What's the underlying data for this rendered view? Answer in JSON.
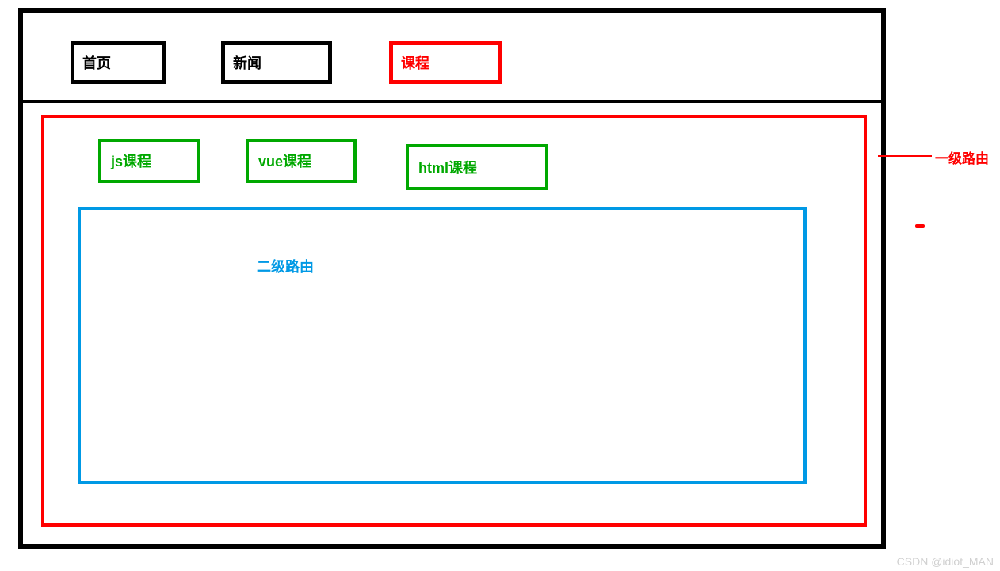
{
  "topNav": {
    "home": "首页",
    "news": "新闻",
    "course": "课程"
  },
  "coursePanel": {
    "js": "js课程",
    "vue": "vue课程",
    "html": "html课程"
  },
  "secondaryRoute": "二级路由",
  "annotation": {
    "primaryRoute": "一级路由"
  },
  "watermark": "CSDN @idiot_MAN"
}
